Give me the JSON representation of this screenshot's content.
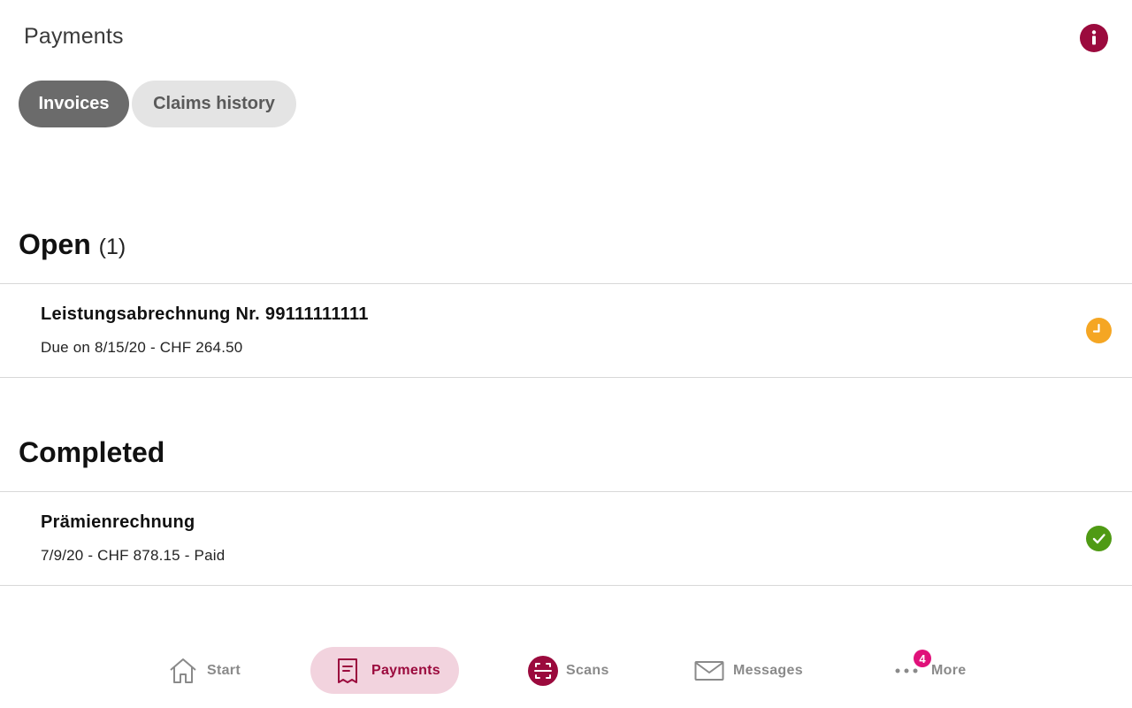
{
  "header": {
    "title": "Payments"
  },
  "tabs": [
    {
      "label": "Invoices",
      "active": true
    },
    {
      "label": "Claims history",
      "active": false
    }
  ],
  "open_section": {
    "title": "Open",
    "count": "(1)",
    "items": [
      {
        "title": "Leistungsabrechnung Nr. 99111111111",
        "subtitle": "Due on 8/15/20 - CHF 264.50",
        "status_icon": "clock-icon",
        "status_color": "#f5a623"
      }
    ]
  },
  "completed_section": {
    "title": "Completed",
    "items": [
      {
        "title": "Prämienrechnung",
        "subtitle": "7/9/20 - CHF 878.15 - Paid",
        "status_icon": "check-icon",
        "status_color": "#4f9a14"
      }
    ]
  },
  "bottom_nav": {
    "items": [
      {
        "label": "Start",
        "icon": "home-icon"
      },
      {
        "label": "Payments",
        "icon": "receipt-icon",
        "active": true
      },
      {
        "label": "Scans",
        "icon": "scan-icon"
      },
      {
        "label": "Messages",
        "icon": "envelope-icon"
      },
      {
        "label": "More",
        "icon": "more-dots-icon",
        "badge": "4"
      }
    ]
  },
  "colors": {
    "brand": "#9b0a3d",
    "active_tab": "#6b6b6b",
    "inactive_tab": "#e4e4e4",
    "nav_active_bg": "#f2d3de",
    "badge": "#e0117a"
  }
}
